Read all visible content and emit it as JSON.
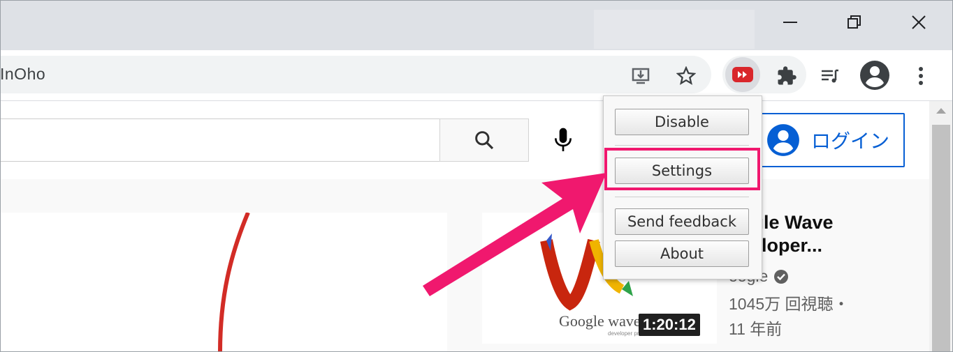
{
  "window": {
    "minimize_icon": "minimize-icon",
    "restore_icon": "restore-icon",
    "close_icon": "close-icon"
  },
  "toolbar": {
    "url_fragment": "InOho",
    "icons": [
      "install-icon",
      "star-icon",
      "extension-active-icon",
      "puzzle-icon",
      "media-queue-icon",
      "profile-icon",
      "menu-dots-icon"
    ],
    "active_extension_color": "#d9262b"
  },
  "page": {
    "search_icon": "search-icon",
    "mic_icon": "mic-icon",
    "login_label": "ログイン",
    "accent_color": "#065fd4"
  },
  "video": {
    "title_line1": "ogle Wave",
    "title_line2": "veloper...",
    "channel": "oogle",
    "views": "1045万 回視聴・",
    "age": "11 年前",
    "duration": "1:20:12",
    "thumb_text": "Google wave",
    "thumb_subtext": "developer preview"
  },
  "popup": {
    "disable": "Disable",
    "settings": "Settings",
    "send_feedback": "Send feedback",
    "about": "About",
    "highlight_color": "#f0186e"
  }
}
